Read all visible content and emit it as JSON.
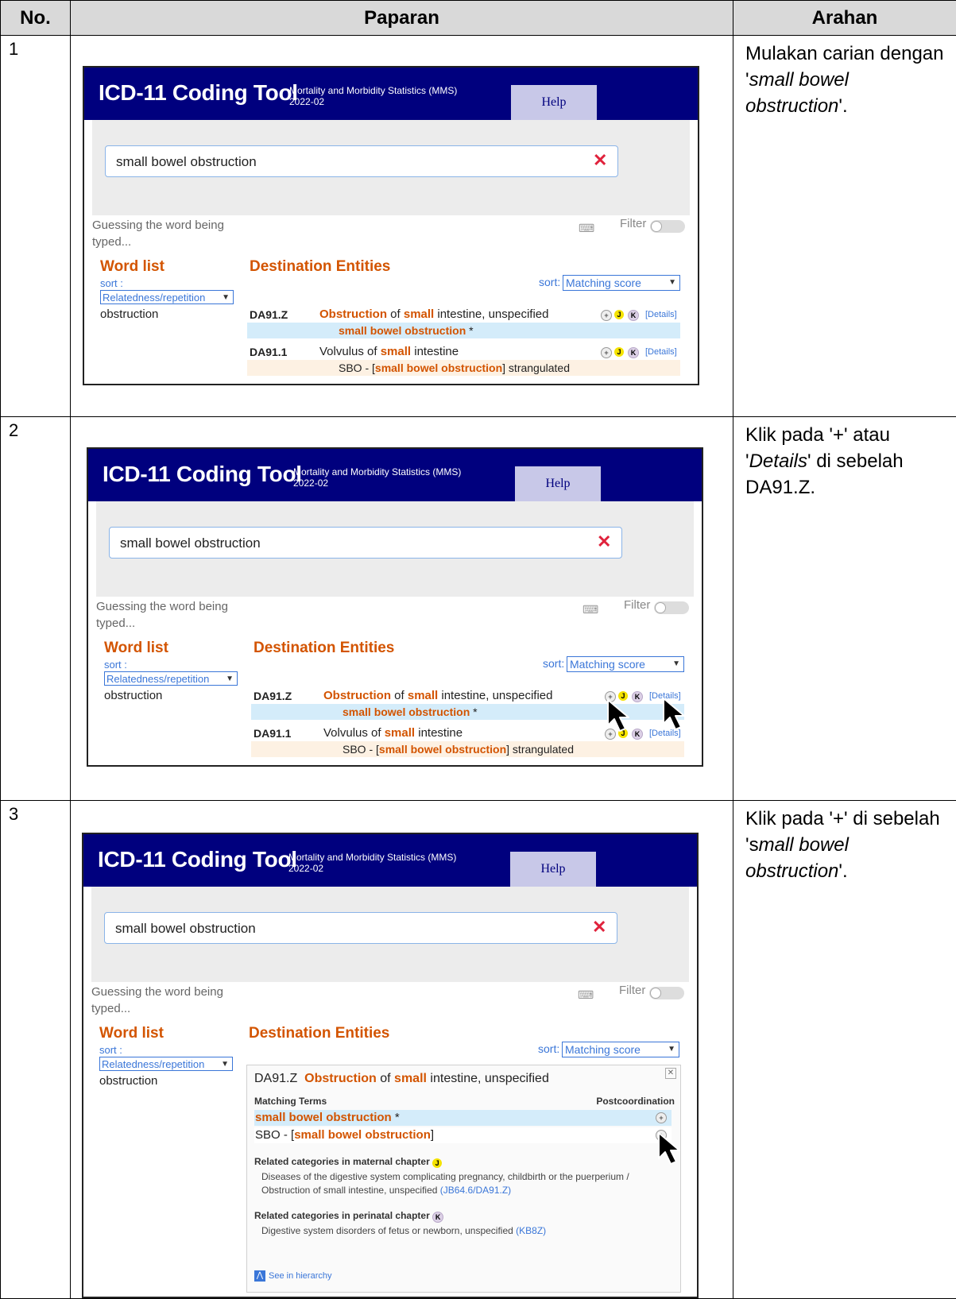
{
  "headers": {
    "no": "No.",
    "display": "Paparan",
    "instruction": "Arahan"
  },
  "rows": [
    {
      "no": "1",
      "instr_a": "Mulakan carian dengan '",
      "instr_em": "small bowel obstruction",
      "instr_b": "'."
    },
    {
      "no": "2",
      "instr_a": "Klik pada '+' atau '",
      "instr_em": "Details",
      "instr_b": "' di sebelah DA91.Z."
    },
    {
      "no": "3",
      "instr_a": "Klik pada '+' di sebelah 's",
      "instr_em": "mall bowel obstruction",
      "instr_b": "'."
    }
  ],
  "tool": {
    "title": "ICD-11 Coding Tool",
    "mms_line1": "Mortality and Morbidity Statistics (MMS)",
    "mms_line2": "2022-02",
    "help": "Help",
    "search_value": "small bowel obstruction",
    "guess_text": "Guessing the word being typed...",
    "filter": "Filter",
    "word_list": "Word list",
    "destination": "Destination Entities",
    "sort_label": "sort :",
    "sort_label_right": "sort:",
    "sort_word": "Relatedness/repetition",
    "sort_dest": "Matching score",
    "word_item": "obstruction",
    "details": "[Details]",
    "badge_j": "J",
    "badge_k": "K",
    "results": [
      {
        "code": "DA91.Z",
        "t1": "Obstruction",
        "t2": " of ",
        "t3": "small",
        "t4": " intestine, unspecified",
        "sub_hl": "small bowel obstruction",
        "sub_tail": " *"
      },
      {
        "code": "DA91.1",
        "t1": "Volvulus of ",
        "t2": "small",
        "t3": " intestine",
        "sub_head": "SBO - [",
        "sub_hl": "small bowel obstruction",
        "sub_tail": "] strangulated"
      }
    ],
    "panel": {
      "code": "DA91.Z",
      "t1": "Obstruction",
      "t2": " of ",
      "t3": "small",
      "t4": " intestine, unspecified",
      "matching_terms": "Matching Terms",
      "postcoordination": "Postcoordination",
      "term1": "small bowel obstruction",
      "term1_tail": " *",
      "term2_head": "SBO - [",
      "term2_hl": "small bowel obstruction",
      "term2_tail": "]",
      "maternal_head": "Related categories in maternal chapter",
      "maternal_l1": "Diseases of the digestive system complicating pregnancy, childbirth or the puerperium /",
      "maternal_l2": "Obstruction of small intestine, unspecified",
      "maternal_code": "(JB64.6/DA91.Z)",
      "perinatal_head": "Related categories in perinatal chapter",
      "perinatal_text": "Digestive system disorders of fetus or newborn, unspecified",
      "perinatal_code": "(KB8Z)",
      "see_hier": "See in hierarchy"
    }
  },
  "colors": {
    "header_bg": "#00007e",
    "accent_orange": "#d35400",
    "link_blue": "#3a76d8",
    "highlight_blue": "#d4ecfa",
    "close_red": "#e0223c"
  }
}
